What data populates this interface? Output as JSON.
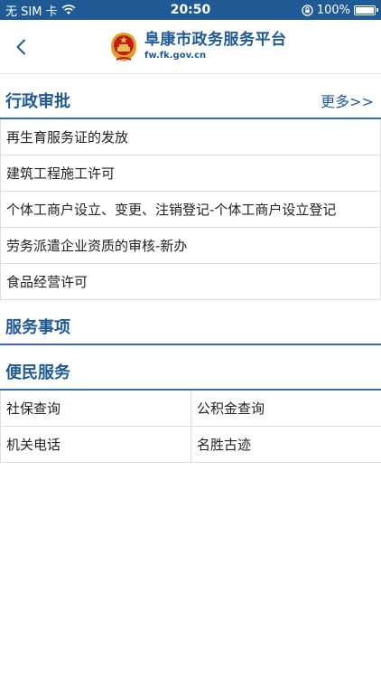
{
  "status_bar": {
    "carrier": "无 SIM 卡",
    "time": "20:50",
    "battery": "100%",
    "battery_level": 1.0
  },
  "nav": {
    "title": "阜康市政务服务平台",
    "url": "fw.fk.gov.cn"
  },
  "sections": {
    "approval": {
      "title": "行政审批",
      "more": "更多>>",
      "items": [
        "再生育服务证的发放",
        "建筑工程施工许可",
        "个体工商户设立、变更、注销登记-个体工商户设立登记",
        "劳务派遣企业资质的审核-新办",
        "食品经营许可"
      ]
    },
    "services": {
      "title": "服务事项"
    },
    "convenience": {
      "title": "便民服务",
      "items": [
        "社保查询",
        "公积金查询",
        "机关电话",
        "名胜古迹"
      ]
    }
  },
  "colors": {
    "accent": "#1f5a95",
    "divider": "#dddddd"
  }
}
